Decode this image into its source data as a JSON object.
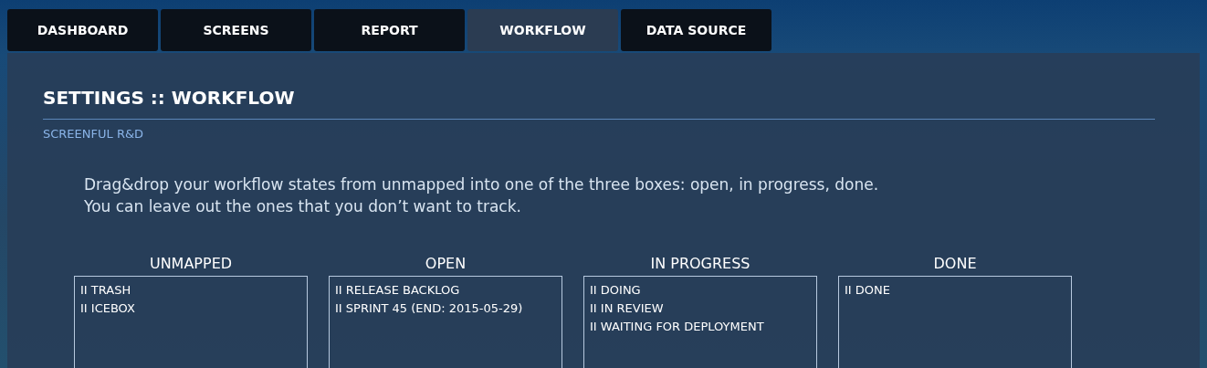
{
  "tabs": [
    {
      "label": "DASHBOARD",
      "selected": false
    },
    {
      "label": "SCREENS",
      "selected": false
    },
    {
      "label": "REPORT",
      "selected": false
    },
    {
      "label": "WORKFLOW",
      "selected": true
    },
    {
      "label": "DATA SOURCE",
      "selected": false
    }
  ],
  "title": "SETTINGS :: WORKFLOW",
  "subtitle": "SCREENFUL R&D",
  "instructions": "Drag&drop your workflow states from unmapped into one of the three boxes: open, in progress, done. You can leave out the ones that you don’t want to track.",
  "columns": [
    {
      "heading": "UNMAPPED",
      "states": [
        "II TRASH",
        "II ICEBOX"
      ]
    },
    {
      "heading": "OPEN",
      "states": [
        "II RELEASE BACKLOG",
        "II SPRINT 45 (END: 2015-05-29)"
      ]
    },
    {
      "heading": "IN PROGRESS",
      "states": [
        "II DOING",
        "II IN REVIEW",
        "II WAITING FOR DEPLOYMENT"
      ]
    },
    {
      "heading": "DONE",
      "states": [
        "II DONE"
      ]
    }
  ]
}
